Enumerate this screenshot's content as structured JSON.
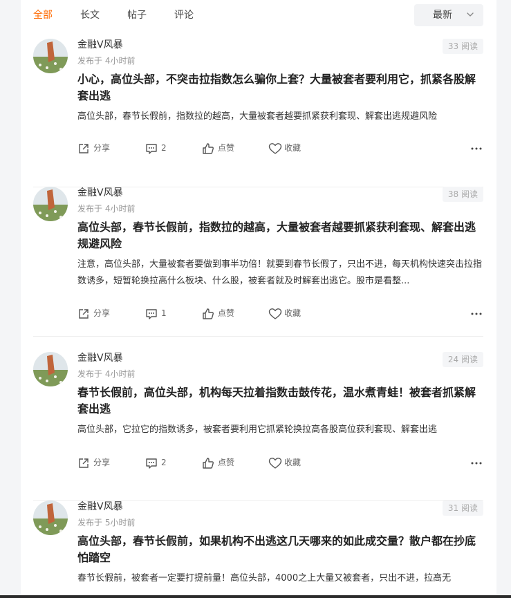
{
  "tabs": [
    {
      "label": "全部",
      "active": true
    },
    {
      "label": "长文",
      "active": false
    },
    {
      "label": "帖子",
      "active": false
    },
    {
      "label": "评论",
      "active": false
    }
  ],
  "sort": {
    "label": "最新"
  },
  "actions": {
    "share": "分享",
    "like": "点赞",
    "fav": "收藏"
  },
  "posts": [
    {
      "author": "金融V风暴",
      "time": "发布于 4小时前",
      "reads": "33 阅读",
      "title": "小心，高位头部，不突击拉指数怎么骗你上套？大量被套者要利用它，抓紧各股解套出逃",
      "summary": "高位头部，春节长假前，指数拉的越高，大量被套者越要抓紧获利套现、解套出逃规避风险",
      "comments": "2"
    },
    {
      "author": "金融V风暴",
      "time": "发布于 4小时前",
      "reads": "38 阅读",
      "title": "高位头部，春节长假前，指数拉的越高，大量被套者越要抓紧获利套现、解套出逃规避风险",
      "summary": "注意，高位头部，大量被套者要做到事半功倍！就要到春节长假了，只出不进，每天机构快速突击拉指数诱多，短暂轮换拉高什么板块、什么股，被套者就及时解套出逃它。股市是看整...",
      "comments": "1"
    },
    {
      "author": "金融V风暴",
      "time": "发布于 4小时前",
      "reads": "24 阅读",
      "title": "春节长假前，高位头部，机构每天拉着指数击鼓传花，温水煮青蛙！被套者抓紧解套出逃",
      "summary": "高位头部，它拉它的指数诱多，被套者要利用它抓紧轮换拉高各股高位获利套现、解套出逃",
      "comments": "2"
    },
    {
      "author": "金融V风暴",
      "time": "发布于 5小时前",
      "reads": "31 阅读",
      "title": "高位头部，春节长假前，如果机构不出逃这几天哪来的如此成交量？散户都在抄底怕踏空",
      "summary": "春节长假前，被套者一定要打提前量！高位头部，4000之上大量又被套者，只出不进，拉高无",
      "comments": ""
    }
  ],
  "colors": {
    "accent": "#ff6a00",
    "text": "#222222",
    "muted": "#999999",
    "reads_bg": "#f4f5f7"
  }
}
